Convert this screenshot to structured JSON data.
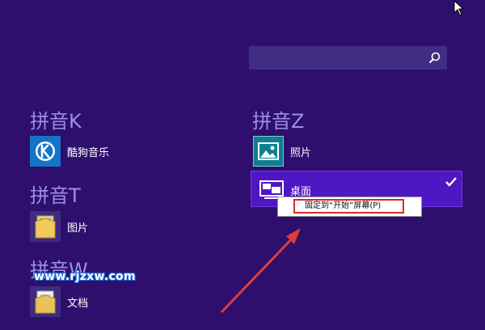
{
  "search": {
    "value": "",
    "placeholder": ""
  },
  "groups": [
    {
      "header": "拼音K",
      "apps": [
        {
          "label": "酷狗音乐",
          "icon": "kugou-music-icon"
        }
      ]
    },
    {
      "header": "拼音T",
      "apps": [
        {
          "label": "图片",
          "icon": "folder-icon"
        }
      ]
    },
    {
      "header": "拼音W",
      "apps": [
        {
          "label": "文档",
          "icon": "folder-icon"
        }
      ]
    },
    {
      "header": "拼音Z",
      "apps": [
        {
          "label": "照片",
          "icon": "photos-icon"
        },
        {
          "label": "桌面",
          "icon": "desktop-icon",
          "selected": true
        }
      ]
    }
  ],
  "context_menu": {
    "pin_label": "固定到“开始”屏幕(P)"
  },
  "watermark": "www.rjzxw.com",
  "colors": {
    "background": "#2e0f6e",
    "header": "#9d8fe6",
    "selected": "#4f16c4",
    "highlight_box": "#d42c2c",
    "arrow": "#e23b3b"
  }
}
